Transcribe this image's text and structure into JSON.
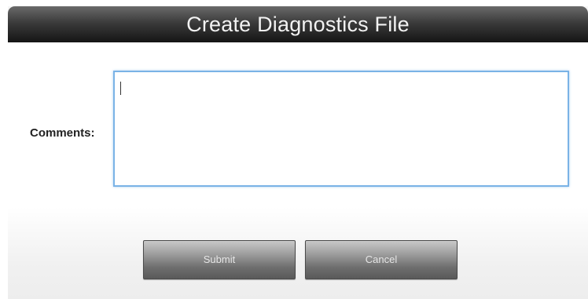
{
  "dialog": {
    "title": "Create Diagnostics File",
    "comments_label": "Comments:",
    "comments_value": "",
    "submit_label": "Submit",
    "cancel_label": "Cancel"
  }
}
